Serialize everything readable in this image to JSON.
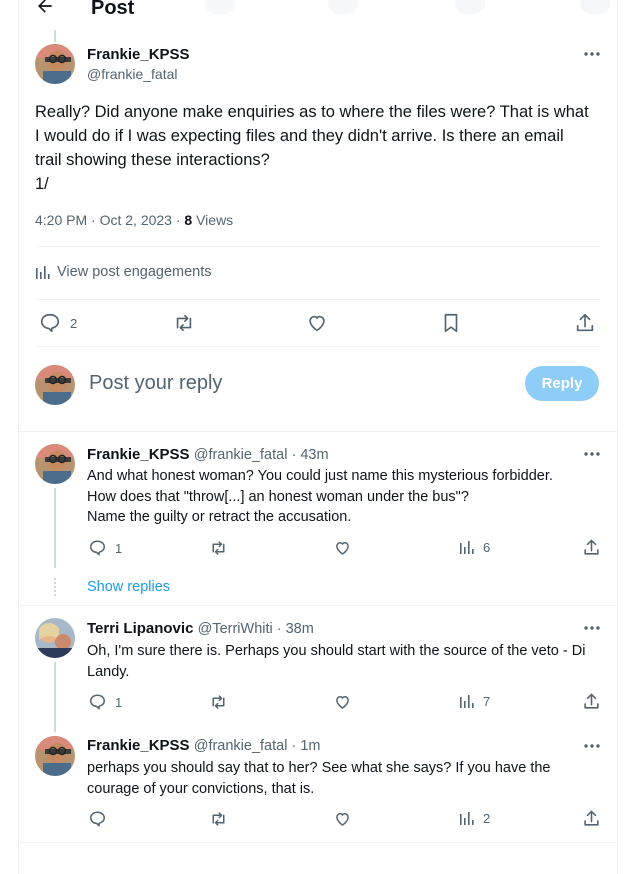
{
  "header": {
    "title": "Post"
  },
  "main_post": {
    "author_name": "Frankie_KPSS",
    "author_handle": "@frankie_fatal",
    "text_lines": [
      "Really? Did anyone make enquiries as to where the files were? That is what",
      "I would do if I was expecting files and they didn't arrive. Is there an email",
      "trail showing these interactions?",
      "1/"
    ],
    "timestamp": "4:20 PM · Oct 2, 2023 · ",
    "views_count": "8",
    "views_label": "Views",
    "engagements_label": "View post engagements",
    "reply_count": "2"
  },
  "composer": {
    "placeholder": "Post your reply",
    "button_label": "Reply"
  },
  "replies": [
    {
      "author_name": "Frankie_KPSS",
      "author_handle": "@frankie_fatal",
      "time": " · 43m",
      "text_lines": [
        "And what honest woman? You could just name this mysterious forbidder.",
        "How does that \"throw[...] an honest woman under the bus\"?",
        "Name the guilty or retract the accusation."
      ],
      "reply_count": "1",
      "views": "6",
      "show_replies": "Show replies"
    },
    {
      "author_name": "Terri Lipanovic",
      "author_handle": "@TerriWhiti",
      "time": " · 38m",
      "text_lines": [
        "Oh, I'm sure there is. Perhaps you should start with the source of the veto - Di",
        "Landy."
      ],
      "reply_count": "1",
      "views": "7"
    },
    {
      "author_name": "Frankie_KPSS",
      "author_handle": "@frankie_fatal",
      "time": " · 1m",
      "text_lines": [
        "perhaps you should say that to her? See what she says? If you have the",
        "courage of your convictions, that is."
      ],
      "reply_count": "",
      "views": "2"
    }
  ],
  "colors": {
    "accent": "#1d9bf0",
    "reply_button_disabled": "#8ecdf8",
    "muted": "#536471"
  }
}
